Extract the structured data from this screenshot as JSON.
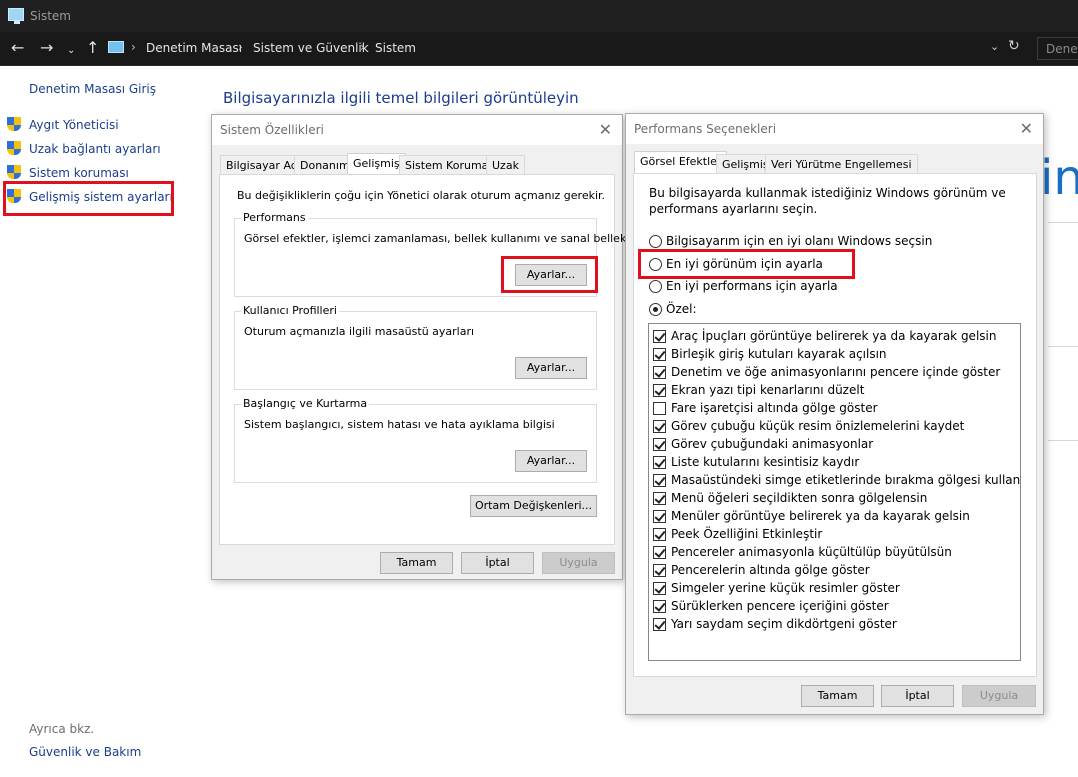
{
  "window": {
    "title": "Sistem"
  },
  "address": {
    "breadcrumbs": [
      "Denetim Masası",
      "Sistem ve Güvenlik",
      "Sistem"
    ],
    "search_placeholder": "Denet"
  },
  "sidebar": {
    "home": "Denetim Masası Giriş",
    "items": [
      {
        "label": "Aygıt Yöneticisi",
        "icon": "shield-icon"
      },
      {
        "label": "Uzak bağlantı ayarları",
        "icon": "shield-icon"
      },
      {
        "label": "Sistem koruması",
        "icon": "shield-icon"
      },
      {
        "label": "Gelişmiş sistem ayarları",
        "icon": "shield-icon",
        "highlighted": true
      }
    ],
    "see_also": "Ayrıca bkz.",
    "security": "Güvenlik ve Bakım"
  },
  "main": {
    "heading": "Bilgisayarınızla ilgili temel bilgileri görüntüleyin",
    "bg_text": "ind"
  },
  "system_props": {
    "title": "Sistem Özellikleri",
    "tabs": [
      "Bilgisayar Adı",
      "Donanım",
      "Gelişmiş",
      "Sistem Koruması",
      "Uzak"
    ],
    "active_tab": "Gelişmiş",
    "admin_note": "Bu değişikliklerin çoğu için Yönetici olarak oturum açmanız gerekir.",
    "performance": {
      "label": "Performans",
      "desc": "Görsel efektler, işlemci zamanlaması, bellek kullanımı ve sanal bellek",
      "button": "Ayarlar..."
    },
    "profiles": {
      "label": "Kullanıcı Profilleri",
      "desc": "Oturum açmanızla ilgili masaüstü ayarları",
      "button": "Ayarlar..."
    },
    "startup": {
      "label": "Başlangıç ve Kurtarma",
      "desc": "Sistem başlangıcı, sistem hatası ve hata ayıklama bilgisi",
      "button": "Ayarlar..."
    },
    "env_button": "Ortam Değişkenleri...",
    "ok": "Tamam",
    "cancel": "İptal",
    "apply": "Uygula"
  },
  "perf_options": {
    "title": "Performans Seçenekleri",
    "tabs": [
      "Görsel Efektler",
      "Gelişmiş",
      "Veri Yürütme Engellemesi"
    ],
    "active_tab": "Görsel Efektler",
    "intro_line1": "Bu bilgisayarda kullanmak istediğiniz Windows görünüm ve",
    "intro_line2": "performans ayarlarını seçin.",
    "radios": [
      {
        "label": "Bilgisayarım için en iyi olanı Windows seçsin",
        "checked": false
      },
      {
        "label": "En iyi görünüm için ayarla",
        "checked": false
      },
      {
        "label": "En iyi performans için ayarla",
        "checked": false
      },
      {
        "label": "Özel:",
        "checked": true
      }
    ],
    "effects": [
      {
        "label": "Araç İpuçları görüntüye belirerek ya da kayarak gelsin",
        "checked": true
      },
      {
        "label": "Birleşik giriş kutuları kayarak açılsın",
        "checked": true
      },
      {
        "label": "Denetim ve öğe animasyonlarını pencere içinde göster",
        "checked": true
      },
      {
        "label": "Ekran yazı tipi kenarlarını düzelt",
        "checked": true
      },
      {
        "label": "Fare işaretçisi altında gölge göster",
        "checked": false
      },
      {
        "label": "Görev çubuğu küçük resim önizlemelerini kaydet",
        "checked": true
      },
      {
        "label": "Görev çubuğundaki animasyonlar",
        "checked": true
      },
      {
        "label": "Liste kutularını kesintisiz kaydır",
        "checked": true
      },
      {
        "label": "Masaüstündeki simge etiketlerinde bırakma gölgesi kullan",
        "checked": true
      },
      {
        "label": "Menü öğeleri seçildikten sonra gölgelensin",
        "checked": true
      },
      {
        "label": "Menüler görüntüye belirerek ya da kayarak gelsin",
        "checked": true
      },
      {
        "label": "Peek Özelliğini Etkinleştir",
        "checked": true
      },
      {
        "label": "Pencereler animasyonla küçültülüp büyütülsün",
        "checked": true
      },
      {
        "label": "Pencerelerin altında gölge göster",
        "checked": true
      },
      {
        "label": "Simgeler yerine küçük resimler göster",
        "checked": true
      },
      {
        "label": "Sürüklerken pencere içeriğini göster",
        "checked": true
      },
      {
        "label": "Yarı saydam seçim dikdörtgeni göster",
        "checked": true
      }
    ],
    "ok": "Tamam",
    "cancel": "İptal",
    "apply": "Uygula"
  },
  "colors": {
    "highlight": "#e0101c",
    "link": "#1a3e8c",
    "heading": "#1e3c8c"
  }
}
